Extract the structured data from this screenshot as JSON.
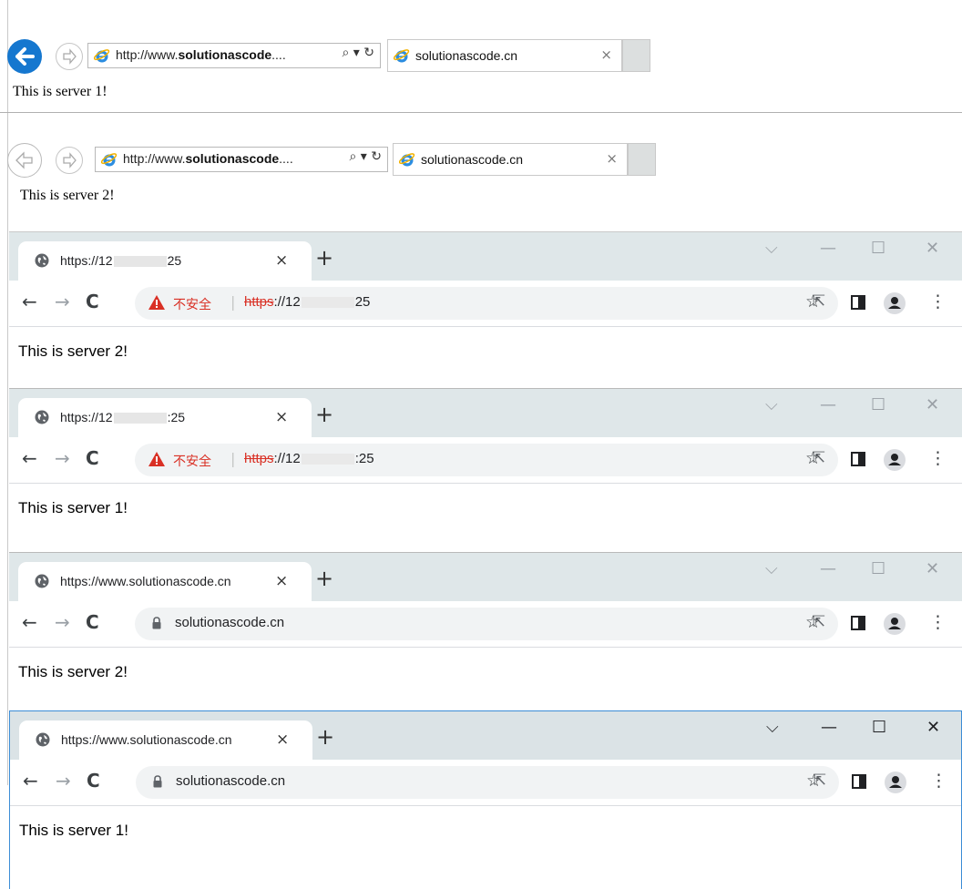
{
  "ie_windows": [
    {
      "address_prefix": "http://www.",
      "address_bold": "solutionascode",
      "address_suffix": "....",
      "address_controls": "⌕ ▾ ↻",
      "tab_title": "solutionascode.cn",
      "tab_close": "×",
      "page_text": "This is server 1!"
    },
    {
      "address_prefix": "http://www.",
      "address_bold": "solutionascode",
      "address_suffix": "....",
      "address_controls": "⌕ ▾ ↻",
      "tab_title": "solutionascode.cn",
      "tab_close": "×",
      "page_text": "This is server 2!"
    }
  ],
  "chrome_windows": [
    {
      "tab_title_start": "https://12",
      "tab_title_end": "25",
      "security_label": "不安全",
      "url_scheme": "https",
      "url_rest_start": "://12",
      "url_rest_end": "25",
      "page_text": "This is server 2!"
    },
    {
      "tab_title_start": "https://12",
      "tab_title_end": ":25",
      "security_label": "不安全",
      "url_scheme": "https",
      "url_rest_start": "://12",
      "url_rest_end": ":25",
      "page_text": "This is server 1!"
    },
    {
      "tab_title": "https://www.solutionascode.cn",
      "url": "solutionascode.cn",
      "page_text": "This is server 2!"
    },
    {
      "tab_title": "https://www.solutionascode.cn",
      "url": "solutionascode.cn",
      "page_text": "This is server 1!"
    }
  ],
  "chrome_common": {
    "tab_close": "×",
    "new_tab": "+",
    "win_dropdown": "⌵",
    "win_min": "—",
    "win_max": "☐",
    "win_close": "✕",
    "back": "←",
    "forward": "→",
    "reload": "C",
    "separator": "|",
    "share": "⇱",
    "star": "☆",
    "menu": "⋮"
  },
  "colors": {
    "ie_back_active": "#1577cf",
    "chrome_tabstrip": "#dfe7e9",
    "chrome_insecure": "#d93025",
    "focused_border": "#3c8dd6"
  }
}
